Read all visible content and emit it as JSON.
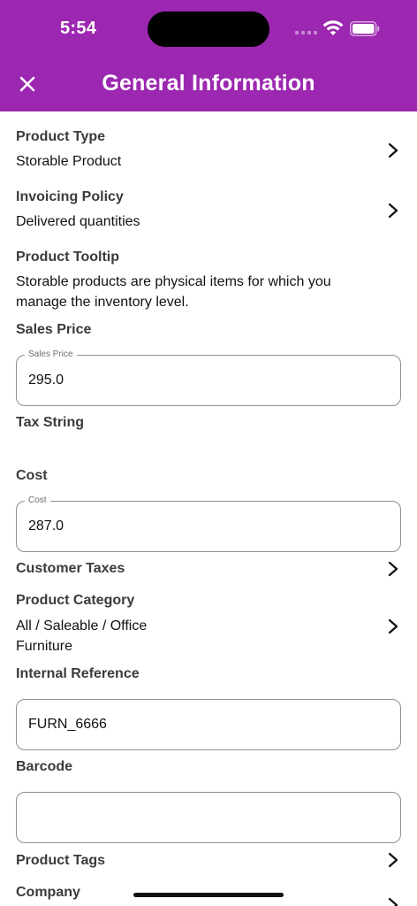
{
  "status_bar": {
    "time": "5:54"
  },
  "header": {
    "title": "General Information",
    "close_icon": "close-icon"
  },
  "fields": {
    "product_type": {
      "label": "Product Type",
      "value": "Storable Product"
    },
    "invoicing_policy": {
      "label": "Invoicing Policy",
      "value": "Delivered quantities"
    },
    "product_tooltip": {
      "label": "Product Tooltip",
      "value_line1": "Storable products are physical items for which you",
      "value_line2": "manage the inventory level."
    },
    "sales_price": {
      "label": "Sales Price",
      "legend": "Sales Price",
      "value": "295.0"
    },
    "tax_string": {
      "label": "Tax String"
    },
    "cost": {
      "label": "Cost",
      "legend": "Cost",
      "value": "287.0"
    },
    "customer_taxes": {
      "label": "Customer Taxes"
    },
    "product_category": {
      "label": "Product Category",
      "value_line1": "All / Saleable / Office",
      "value_line2": "Furniture"
    },
    "internal_reference": {
      "label": "Internal Reference",
      "value": "FURN_6666"
    },
    "barcode": {
      "label": "Barcode",
      "value": ""
    },
    "product_tags": {
      "label": "Product Tags"
    },
    "company": {
      "label": "Company"
    }
  },
  "colors": {
    "accent": "#9c27b0"
  }
}
